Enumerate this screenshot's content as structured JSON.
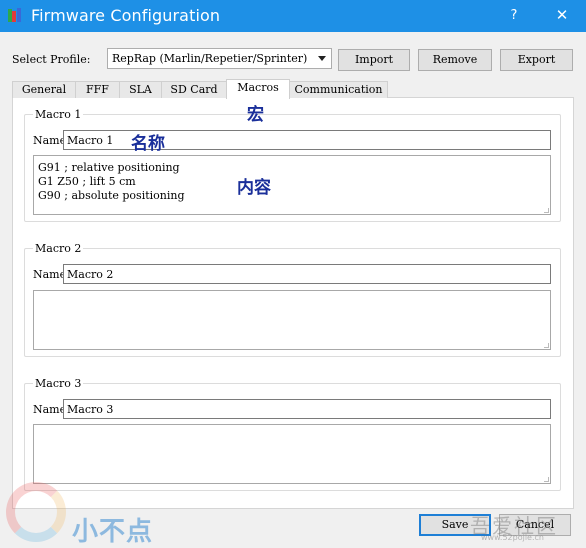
{
  "window": {
    "title": "Firmware Configuration",
    "help_label": "?",
    "close_label": "✕",
    "icon": "app-icon"
  },
  "profile": {
    "label": "Select Profile:",
    "selected": "RepRap (Marlin/Repetier/Sprinter)",
    "buttons": {
      "import": "Import",
      "remove": "Remove",
      "export": "Export"
    }
  },
  "tabs": [
    {
      "label": "General",
      "active": false
    },
    {
      "label": "FFF",
      "active": false
    },
    {
      "label": "SLA",
      "active": false
    },
    {
      "label": "SD Card",
      "active": false
    },
    {
      "label": "Macros",
      "active": true
    },
    {
      "label": "Communication",
      "active": false
    }
  ],
  "macros": [
    {
      "title": "Macro 1",
      "name_label": "Name",
      "name_value": "Macro 1",
      "content": "G91 ; relative positioning\nG1 Z50 ; lift 5 cm\nG90 ; absolute positioning"
    },
    {
      "title": "Macro 2",
      "name_label": "Name",
      "name_value": "Macro 2",
      "content": ""
    },
    {
      "title": "Macro 3",
      "name_label": "Name",
      "name_value": "Macro 3",
      "content": ""
    }
  ],
  "annotations": {
    "macro": "宏",
    "name": "名称",
    "content": "内容"
  },
  "footer": {
    "save_label": "Save",
    "cancel_label": "Cancel"
  },
  "watermark": {
    "left_text": "小不点",
    "right_text": "吾爱社区",
    "right_url": "www.52pojie.cn"
  },
  "colors": {
    "titlebar": "#1e90e6",
    "annotation": "#1a2f9a",
    "default_button_border": "#1e7fd6"
  }
}
